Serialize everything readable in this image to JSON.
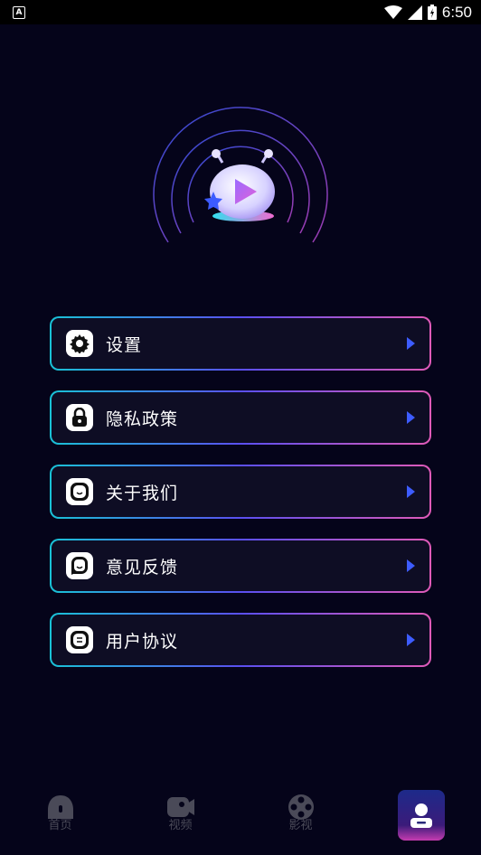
{
  "status_bar": {
    "notification_icon": "A",
    "time": "6:50",
    "icons": [
      "wifi-icon",
      "signal-icon",
      "battery-icon"
    ]
  },
  "hero": {
    "icon": "mascot-play-icon"
  },
  "menu": {
    "items": [
      {
        "label": "设置",
        "icon": "gear-icon"
      },
      {
        "label": "隐私政策",
        "icon": "lock-icon"
      },
      {
        "label": "关于我们",
        "icon": "smile-icon"
      },
      {
        "label": "意见反馈",
        "icon": "feedback-icon"
      },
      {
        "label": "用户协议",
        "icon": "document-icon"
      }
    ]
  },
  "bottom_nav": {
    "items": [
      {
        "label": "首页",
        "icon": "home-icon"
      },
      {
        "label": "视频",
        "icon": "video-camera-icon"
      },
      {
        "label": "影视",
        "icon": "film-reel-icon"
      },
      {
        "label": "",
        "icon": "profile-icon",
        "active": true
      }
    ]
  },
  "colors": {
    "background": "#05041a",
    "accent_blue": "#3d5cff",
    "border_gradient_start": "#19c2d6",
    "border_gradient_end": "#e05ab8"
  }
}
